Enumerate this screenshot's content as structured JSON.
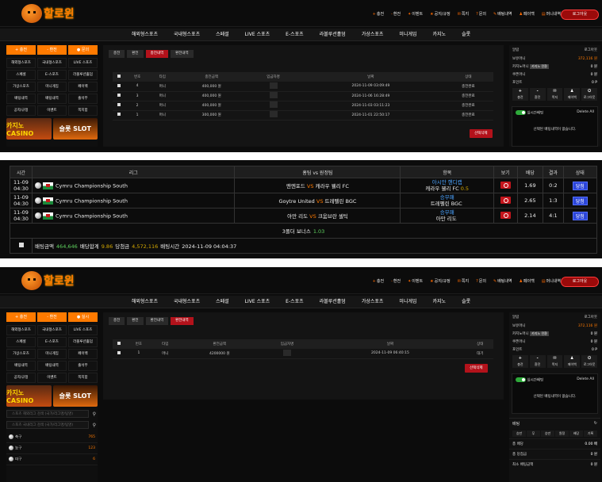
{
  "site": {
    "logo_text": "할로윈",
    "logout": "로그아웃",
    "topnav": [
      {
        "icon": "+",
        "label": "충전"
      },
      {
        "icon": "-",
        "label": "환전"
      },
      {
        "icon": "✦",
        "label": "이벤트"
      },
      {
        "icon": "★",
        "label": "공지/규정"
      },
      {
        "icon": "✉",
        "label": "쪽지"
      },
      {
        "icon": "?",
        "label": "문의"
      },
      {
        "icon": "✎",
        "label": "배팅내역"
      },
      {
        "icon": "♟",
        "label": "페이백"
      },
      {
        "icon": "▤",
        "label": "머니내역"
      }
    ],
    "mainnav": [
      "해외형스포츠",
      "국내형스포츠",
      "스페셜",
      "LIVE 스포츠",
      "E-스포츠",
      "라볼루션홀덤",
      "가상스포츠",
      "미니게임",
      "카지노",
      "슬롯"
    ]
  },
  "left": {
    "tabs": [
      "+ 충전",
      "- 환전",
      "● 문의"
    ],
    "tabs_b": [
      "+ 충전",
      "- 환전",
      "● 실시"
    ],
    "grid": [
      "해외형스포츠",
      "국내형스포츠",
      "LIVE 스포츠",
      "스페셜",
      "E-스포츠",
      "라볼루션홀덤",
      "가상스포츠",
      "미니게임",
      "페이백",
      "배팅내역",
      "배팅내역",
      "출석부",
      "공지/규정",
      "이벤트",
      "쪽지함"
    ],
    "grid_b": [
      "해외형스포츠",
      "국내형스포츠",
      "LIVE 스포츠",
      "스페셜",
      "E-스포츠",
      "라볼루션홀덤",
      "가상스포츠",
      "미니게임",
      "페이백",
      "배팅내역",
      "배팅내역",
      "출석부",
      "공지/규정",
      "이벤트",
      "쪽지함"
    ],
    "promo1": "카지노 CASINO",
    "promo2": "슬롯 SLOT",
    "search1": "스포츠 해외리그 검색 (국가/리그명/팀명)",
    "search2": "스포츠 국내리그 검색 (국가/리그명/팀명)",
    "sports": [
      {
        "name": "축구",
        "count": "765"
      },
      {
        "name": "농구",
        "count": "123"
      },
      {
        "name": "야구",
        "count": "6"
      }
    ]
  },
  "panel_a": {
    "tabs": [
      "충전",
      "환전",
      "충전내역",
      "환전내역"
    ],
    "active": 2,
    "headers": [
      "번호",
      "타입",
      "충전금액",
      "입금자명",
      "날짜",
      "상태"
    ],
    "rows": [
      {
        "no": "4",
        "type": "머니",
        "amount": "400,000 원",
        "date": "2024-11-09 03:09:49",
        "status": "충전완료"
      },
      {
        "no": "3",
        "type": "머니",
        "amount": "400,000 원",
        "date": "2024-11-06 16:28:49",
        "status": "충전완료"
      },
      {
        "no": "2",
        "type": "머니",
        "amount": "400,000 원",
        "date": "2024-11-03 03:11:23",
        "status": "충전완료"
      },
      {
        "no": "1",
        "type": "머니",
        "amount": "300,000 원",
        "date": "2024-11-01 22:50:17",
        "status": "충전완료"
      }
    ],
    "delete_btn": "선택삭제"
  },
  "right": {
    "alarm": "알람",
    "logout": "로그아웃",
    "money_label": "보유머니",
    "money": "372,116 원",
    "casino_label": "카지노머니",
    "casino_btn": "카지노 전환",
    "casino_val": "0 원",
    "coupon_label": "쿠폰머니",
    "coupon_val": "0 원",
    "point_label": "포인트",
    "point_val": "0 P",
    "icons": [
      "충전",
      "환전",
      "쪽지",
      "페이백",
      "로그아웃"
    ],
    "realtime": "실시간배팅",
    "delete_all": "Delete All",
    "empty": "선택된 배팅내역이 없습니다."
  },
  "mid": {
    "headers": [
      "시간",
      "리그",
      "홈팀 vs 원정팀",
      "항목",
      "보기",
      "배당",
      "결과",
      "상태"
    ],
    "rows": [
      {
        "date": "11-09",
        "time": "04:30",
        "league": "Cymru Championship South",
        "home": "맨엔포드",
        "away": "캐라우 웰리 FC",
        "market": "아시안 핸디캡",
        "pick": "캐라우 웰리 FC",
        "line": "0.5",
        "odds": "1.69",
        "result": "0:2",
        "status": "당첨"
      },
      {
        "date": "11-09",
        "time": "04:30",
        "league": "Cymru Championship South",
        "home": "Goytre United",
        "away": "트레펠린 BGC",
        "market": "승무패",
        "pick": "트레펠린 BGC",
        "line": "",
        "odds": "2.65",
        "result": "1:3",
        "status": "당첨"
      },
      {
        "date": "11-09",
        "time": "04:30",
        "league": "Cymru Championship South",
        "home": "아만 리도",
        "away": "크움브란 셀틱",
        "market": "승무패",
        "pick": "아만 리도",
        "line": "",
        "odds": "2.14",
        "result": "4:1",
        "status": "당첨"
      }
    ],
    "bonus_label": "3폴더 보너스",
    "bonus_val": "1.03",
    "footer": {
      "bet_label": "배팅금액",
      "bet": "464,646",
      "odds_label": "배당합계",
      "odds": "9.86",
      "win_label": "당첨금",
      "win": "4,572,116",
      "time_label": "배팅시간",
      "time": "2024-11-09 04:04:37"
    }
  },
  "panel_b": {
    "tabs": [
      "충전",
      "환전",
      "환전내역",
      "환전내역"
    ],
    "active": 3,
    "headers": [
      "번호",
      "타입",
      "환전금액",
      "입금자명",
      "날짜",
      "상태"
    ],
    "rows": [
      {
        "no": "1",
        "type": "머니",
        "amount": "4200000 원",
        "date": "2024-11-09 06:40:15",
        "status": "대기"
      }
    ],
    "delete_btn": "선택삭제",
    "bet_title": "배팅",
    "col": [
      "승만",
      "무",
      "승만",
      "원정",
      "배당",
      "기록"
    ],
    "summary": [
      {
        "k": "총 배당",
        "v": "0.00 배"
      },
      {
        "k": "총 당첨금",
        "v": "0 원"
      },
      {
        "k": "최소 배팅금액",
        "v": "0 원"
      }
    ]
  }
}
